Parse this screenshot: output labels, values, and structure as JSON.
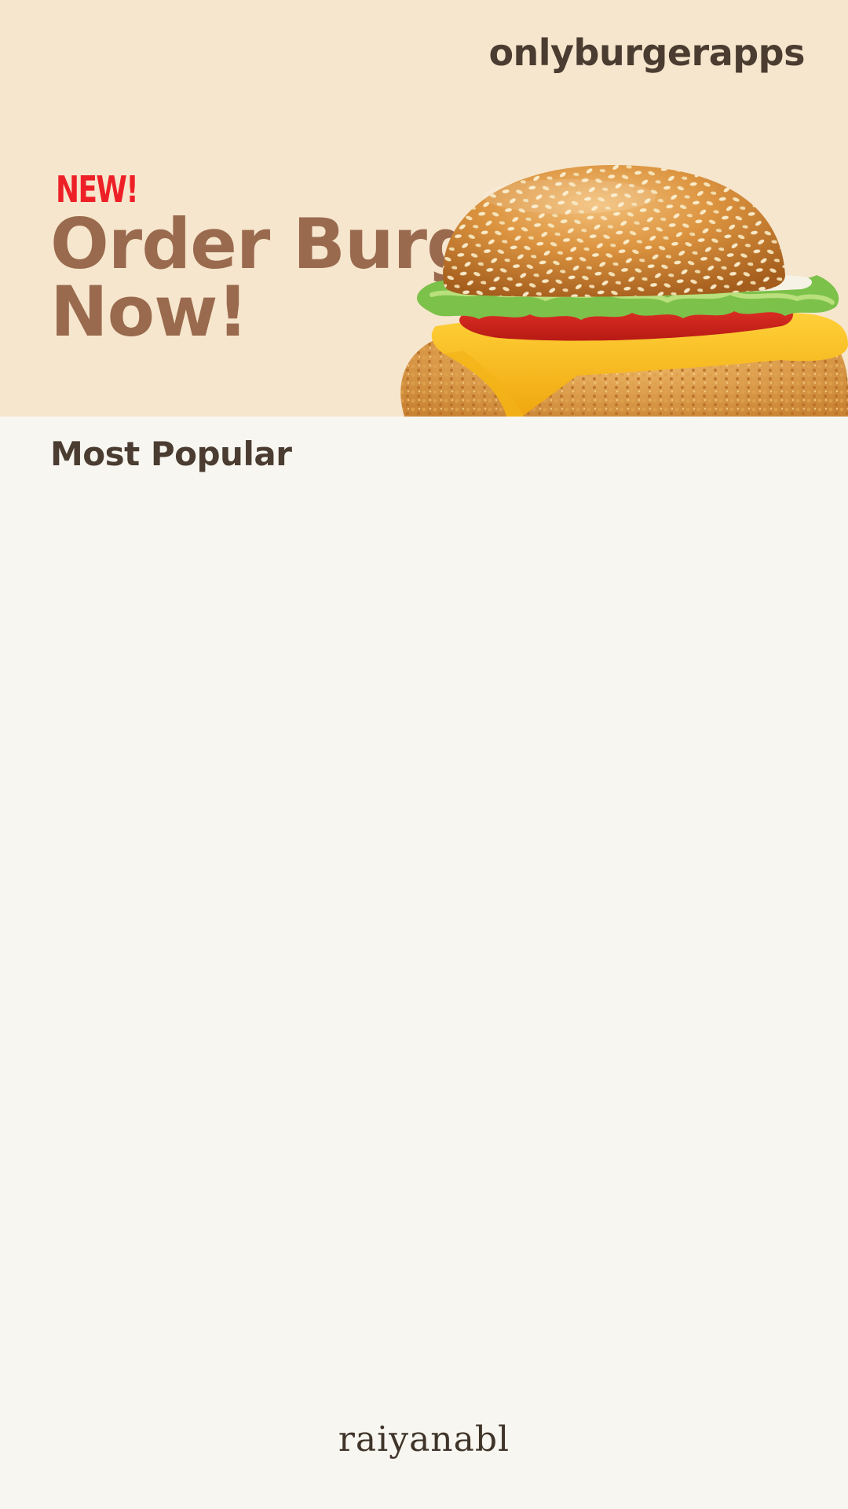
{
  "app": {
    "brand_name": "onlyburgerapps"
  },
  "hero": {
    "badge": "NEW!",
    "headline_line1": "Order Burger",
    "headline_line2": "Now!",
    "image": "burger-photo"
  },
  "most_popular": {
    "title": "Most Popular",
    "items": []
  },
  "footer": {
    "credit": "raiyanabl"
  },
  "colors": {
    "hero_background": "#f6e6cd",
    "page_background": "#f8f6f1",
    "badge": "#ee2027",
    "headline": "#9a6a4e",
    "dark_text": "#4a3c30"
  }
}
